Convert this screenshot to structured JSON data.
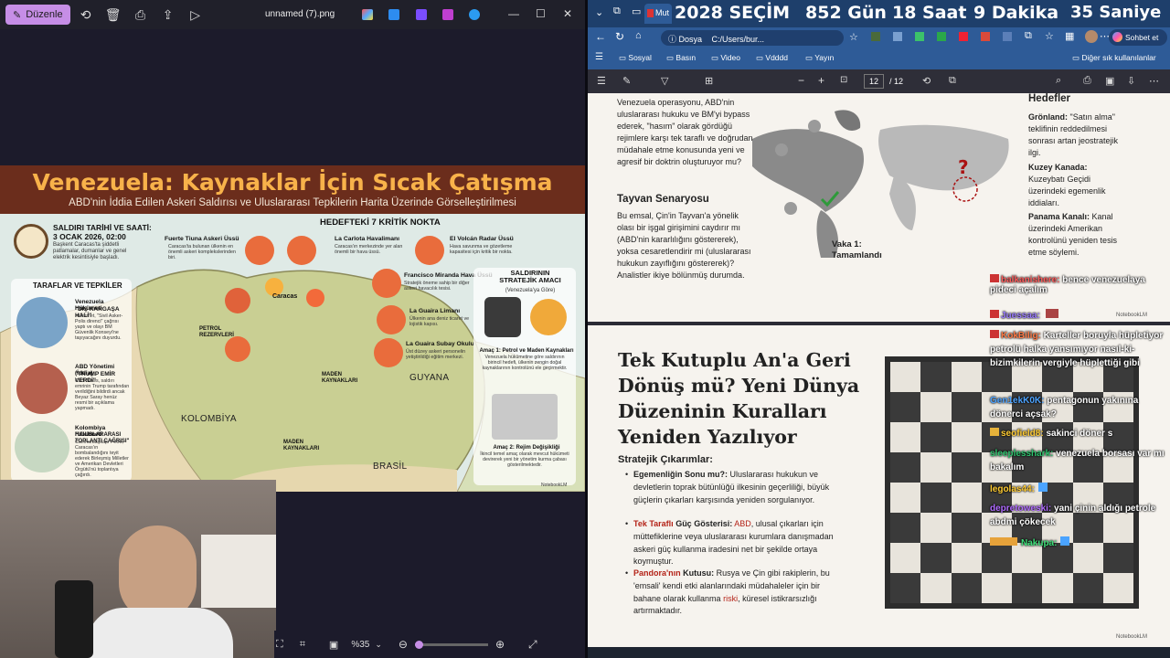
{
  "viewer": {
    "edit_button": "Düzenle",
    "filename": "unnamed (7).png",
    "zoom": "%35"
  },
  "infographic": {
    "title": "Venezuela: Kaynaklar İçin Sıcak Çatışma",
    "subtitle": "ABD'nin İddia Edilen Askeri Saldırısı ve Uluslararası Tepkilerin Harita Üzerinde Görselleştirilmesi",
    "attack_date_label": "SALDIRI TARİHİ VE SAATİ:",
    "attack_date": "3 OCAK 2026, 02:00",
    "attack_date_desc": "Başkent Caracas'ta şiddetli patlamalar, dumanlar ve genel elektrik kesintisiyle başladı.",
    "parties_title": "TARAFLAR VE TEPKİLER",
    "parties": [
      {
        "name": "Venezuela Hükümeti",
        "quote": "\"DIŞ KARGAŞA HALİ\"",
        "desc": "Hükümet, \"Sivil Asker-Polis direnci\" çağrısı yaptı ve olayı BM Güvenlik Konseyi'ne taşıyacağını duyurdu."
      },
      {
        "name": "ABD Yönetimi (İddia)",
        "quote": "\"TRUMP EMİR VERDİ\"",
        "desc": "CBS News, saldırı emrinin Trump tarafından verildiğini bildirdi ancak Beyaz Saray henüz resmi bir açıklama yapmadı."
      },
      {
        "name": "Kolombiya Hükümeti",
        "quote": "\"ULUSLARARASI TOPLANTI ÇAĞRISI\"",
        "desc": "Cumhurbaşkanı Petro, Caracas'ın bombalandığını teyit ederek Birleşmiş Milletler ve Amerikan Devletleri Örgütü'nü toplantıya çağırdı."
      }
    ],
    "targets_title": "HEDEFTEKİ 7 KRİTİK NOKTA",
    "targets": [
      {
        "name": "Fuerte Tiuna Askeri Üssü",
        "desc": "Caracas'ta bulunan ülkenin en önemli askeri komplekslerinden biri."
      },
      {
        "name": "La Carlota Havalimanı",
        "desc": "Caracas'ın merkezinde yer alan önemli bir hava üssü."
      },
      {
        "name": "El Volcán Radar Üssü",
        "desc": "Hava savunma ve gözetleme kapasitesi için kritik bir nokta."
      },
      {
        "name": "Francisco Miranda Hava Üssü",
        "desc": "Stratejik öneme sahip bir diğer askeri havacılık tesisi."
      },
      {
        "name": "La Guaira Limanı",
        "desc": "Ülkenin ana deniz ticaret ve lojistik kapısı."
      },
      {
        "name": "La Guaira Subay Okulu",
        "desc": "Üst düzey askeri personelin yetiştirildiği eğitim merkezi."
      }
    ],
    "map_labels": {
      "caracas": "Caracas",
      "petrol": "PETROL\nREZERVLERİ",
      "maden1": "MADEN\nKAYNAKLARI",
      "maden2": "MADEN\nKAYNAKLARI",
      "kolombiya": "KOLOMBİYA",
      "guyana": "GUYANA",
      "brasil": "BRASİL"
    },
    "purpose_title": "SALDIRININ STRATEJİK AMACI",
    "purpose_sub": "(Venezuela'ya Göre)",
    "purpose": [
      {
        "name": "Amaç 1: Petrol ve Maden Kaynakları",
        "desc": "Venezuela hükümetine göre saldırının birincil hedefi, ülkenin zengin doğal kaynaklarının kontrolünü ele geçirmektir."
      },
      {
        "name": "Amaç 2: Rejim Değişikliği",
        "desc": "İkincil temel amaç olarak mevcut hükümeti devirerek yeni bir yönetim kurma çabası gösterilmektedir."
      }
    ],
    "notebook": "NotebookLM"
  },
  "browser": {
    "tab_short": "Mut",
    "countdown": {
      "label": "2028 SEÇİM",
      "days": "852 Gün",
      "hours": "18 Saat",
      "minutes": "9 Dakika",
      "seconds": "35 Saniye"
    },
    "address_prefix": "Dosya",
    "address": "C:/Users/bur...",
    "chat_button": "Sohbet et",
    "bookmarks": [
      "Sosyal",
      "Basın",
      "Video",
      "Vdddd",
      "Yayın"
    ],
    "other_bookmarks": "Diğer sık kullanılanlar",
    "page_current": "12",
    "page_total": "/ 12"
  },
  "page1": {
    "left_para": "Venezuela operasyonu, ABD'nin uluslararası hukuku ve BM'yi bypass ederek, \"hasım\" olarak gördüğü rejimlere karşı tek taraflı ve doğrudan müdahale etme konusunda yeni ve agresif bir doktrin oluşturuyor mu?",
    "taiwan_title": "Tayvan Senaryosu",
    "taiwan_para": "Bu emsal, Çin'in Tayvan'a yönelik olası bir işgal girişimini caydırır mı (ABD'nin kararlılığını göstererek), yoksa cesaretlendirir mi (uluslararası hukukun zayıflığını göstererek)? Analistler ikiye bölünmüş durumda.",
    "case_label": "Vaka 1:\nTamamlandı",
    "targets_title": "Hedefler",
    "targets": [
      {
        "bold": "Grönland:",
        "text": " \"Satın alma\" teklifinin reddedilmesi sonrası artan jeostratejik ilgi."
      },
      {
        "bold": "Kuzey Kanada:",
        "text": " Kuzeybatı Geçidi üzerindeki egemenlik iddiaları."
      },
      {
        "bold": "Panama Kanalı:",
        "text": " Kanal üzerindeki Amerikan kontrolünü yeniden tesis etme söylemi."
      }
    ],
    "notebook": "NotebookLM"
  },
  "page2": {
    "title_lines": [
      "Tek Kutuplu An'a Geri",
      "Dönüş mü? Yeni Dünya",
      "Düzeninin Kuralları",
      "Yeniden Yazılıyor"
    ],
    "section": "Stratejik Çıkarımlar:",
    "b1_title": "Egemenliğin Sonu mu?:",
    "b1_text": " Uluslararası hukukun ve devletlerin toprak bütünlüğü ilkesinin geçerliliği, büyük güçlerin çıkarları karşısında yeniden sorgulanıyor.",
    "b2_title": "Tek Taraflı",
    "b2_title2": " Güç Gösterisi:",
    "b2_abd": "ABD",
    "b2_text": ", ulusal çıkarları için müttefiklerine veya uluslararası kurumlara danışmadan askeri güç kullanma iradesini net bir şekilde ortaya koymuştur.",
    "b3_title": "Pandora'nın",
    "b3_title2": " Kutusu:",
    "b3_text": " Rusya ve Çin gibi rakiplerin, bu 'emsali' kendi etki alanlarındaki müdahaleler için bir bahane olarak kullanma ",
    "b3_risk": "riski",
    "b3_end": ", küresel istikrarsızlığı artırmaktadır.",
    "notebook": "NotebookLM"
  },
  "chat": [
    {
      "user": "balkanishere:",
      "msg": " bence venezuelaya pideci açalım",
      "color": "#ff5c5c"
    },
    {
      "user": "Juessaa:",
      "msg": "",
      "color": "#9a7cff"
    },
    {
      "user": "KokBilig:",
      "msg": " Karteller boruyla hüpletiyor petrolü halka yansımıyor nasıl-ki-bizimkilerin vergiyle hüplettiği gibi",
      "color": "#ff7a45"
    },
    {
      "user": "Gen1ekK0K:",
      "msg": " pentagonun yakınına dönerci açsak?",
      "color": "#4da3ff"
    },
    {
      "user": "seofield8:",
      "msg": " sakinci döner s",
      "color": "#ffcc33"
    },
    {
      "user": "sleeplesshark:",
      "msg": " venezuela borsası var mı bakalım",
      "color": "#2ec46e"
    },
    {
      "user": "legolas44:",
      "msg": "",
      "color": "#ffcc33"
    },
    {
      "user": "depretoweski:",
      "msg": " yani çinin aldığı petrole abdmi çökecek",
      "color": "#b06cff"
    },
    {
      "user": "Nakupa:",
      "msg": "",
      "color": "#3ee07a"
    }
  ]
}
